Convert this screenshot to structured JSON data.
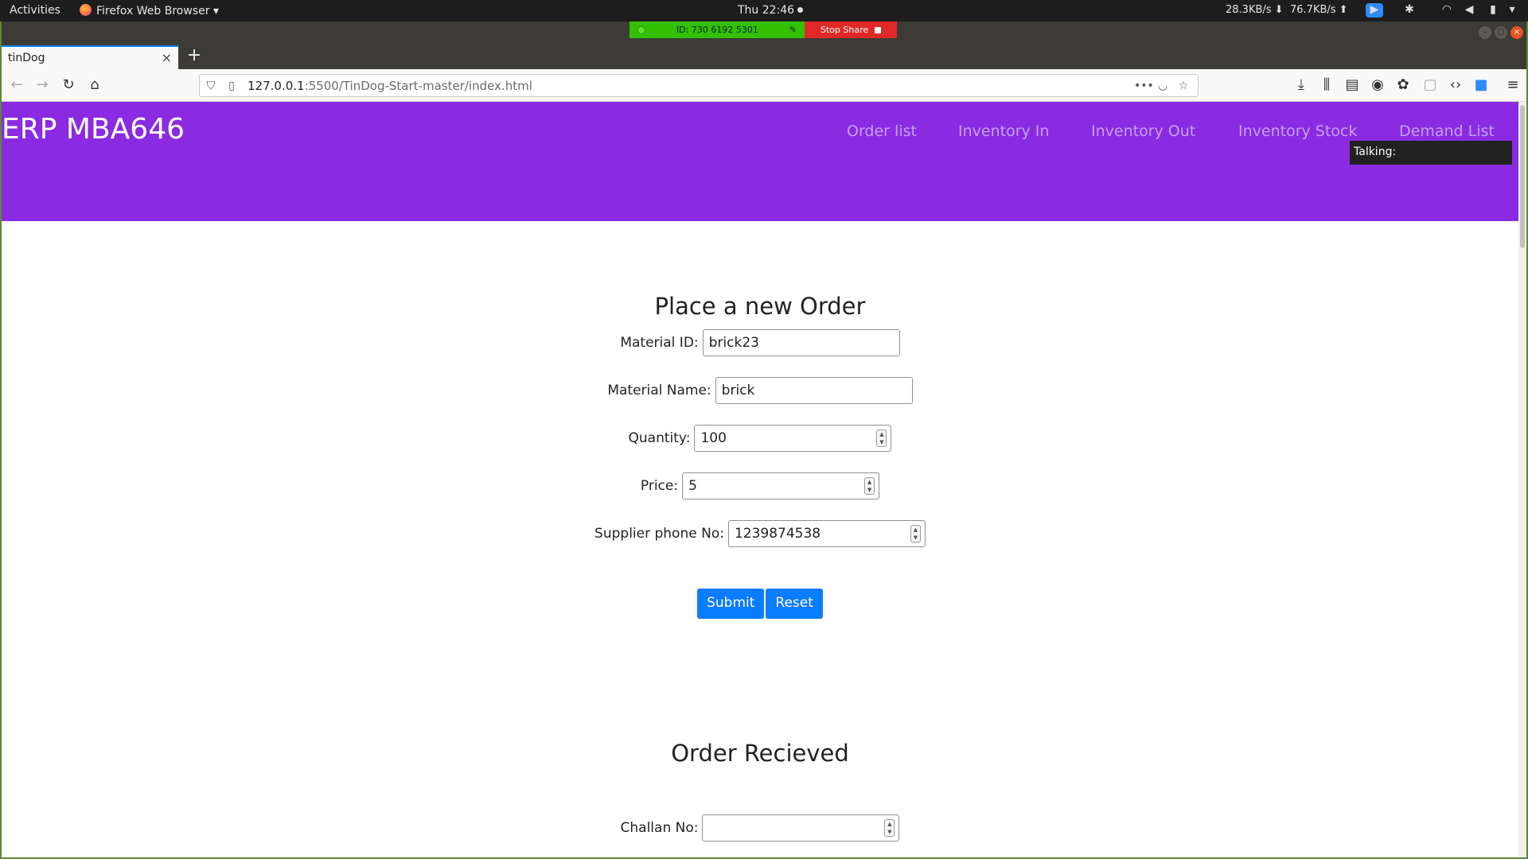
{
  "system": {
    "activities": "Activities",
    "app_menu": "Firefox Web Browser",
    "clock": "Thu 22:46",
    "net_down": "28.3KB/s",
    "net_up": "76.7KB/s"
  },
  "meeting": {
    "id_label": "ID: 730 6192 5301",
    "stop_label": "Stop Share",
    "talking_label": "Talking:"
  },
  "browser": {
    "tab_title": "tinDog",
    "url_host": "127.0.0.1",
    "url_path": ":5500/TinDog-Start-master/index.html",
    "icons": [
      "back-icon",
      "forward-icon",
      "reload-icon",
      "home-icon",
      "shield-icon",
      "page-icon",
      "more-icon",
      "pocket-icon",
      "bookmark-star-icon",
      "downloads-icon",
      "library-icon",
      "sidebar-icon",
      "account-icon",
      "extension-icon",
      "devtools-icon",
      "zoom-icon",
      "menu-icon"
    ]
  },
  "site": {
    "brand": "ERP MBA646",
    "nav": [
      "Order list",
      "Inventory In",
      "Inventory Out",
      "Inventory Stock",
      "Demand List"
    ],
    "accent_color": "#8a2be2",
    "button_color": "#0a7cff"
  },
  "order_form": {
    "title": "Place a new Order",
    "fields": {
      "material_id": {
        "label": "Material ID:",
        "value": "brick23"
      },
      "material_name": {
        "label": "Material Name:",
        "value": "brick"
      },
      "quantity": {
        "label": "Quantity:",
        "value": "100"
      },
      "price": {
        "label": "Price:",
        "value": "5"
      },
      "supplier_phone": {
        "label": "Supplier phone No:",
        "value": "1239874538"
      }
    },
    "submit_label": "Submit",
    "reset_label": "Reset"
  },
  "received_form": {
    "title": "Order Recieved",
    "challan_label": "Challan No:",
    "challan_value": ""
  }
}
